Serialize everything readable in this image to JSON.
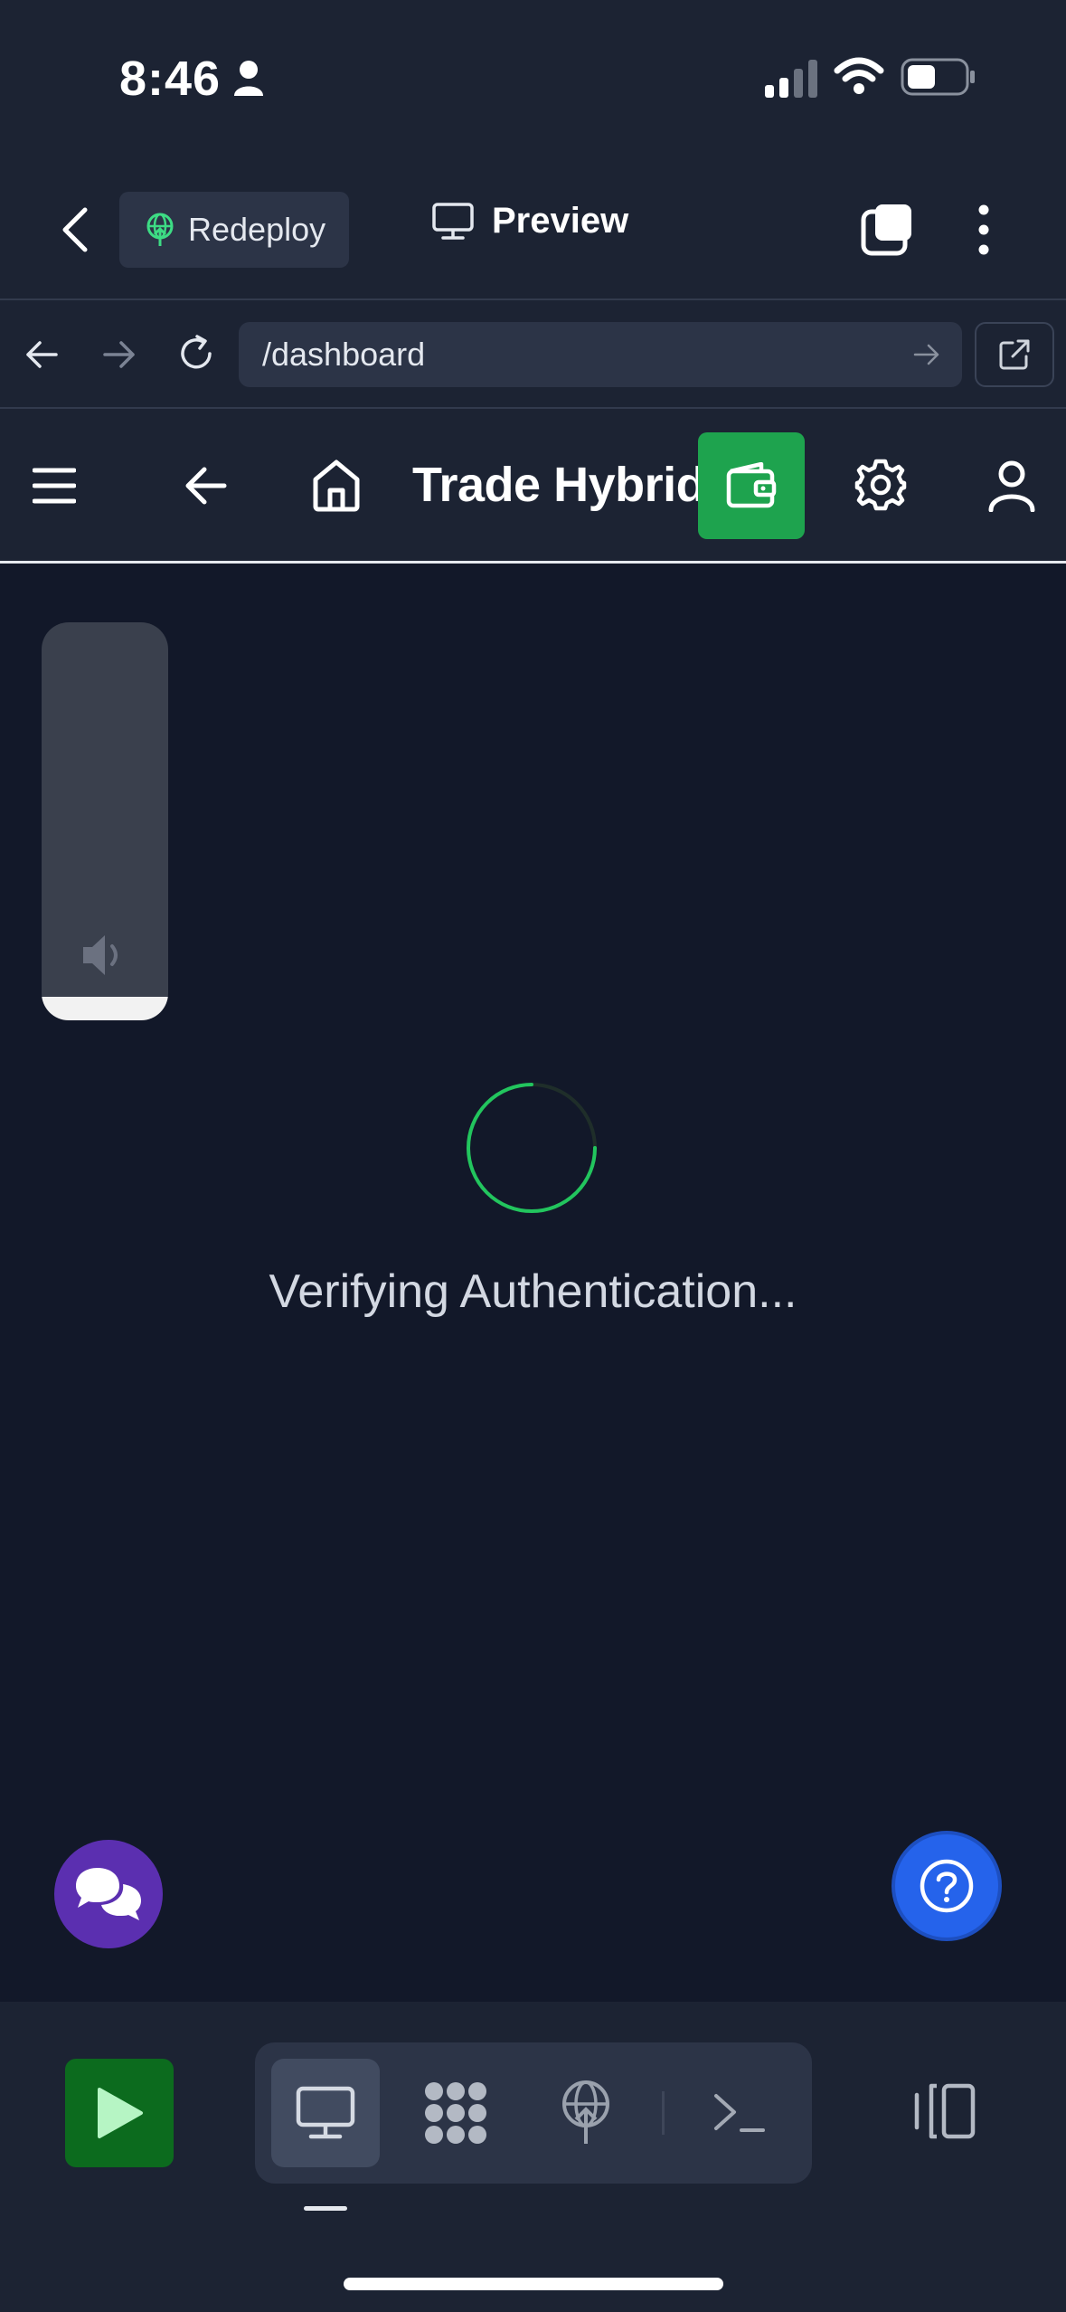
{
  "status_bar": {
    "time": "8:46"
  },
  "top_bar": {
    "redeploy_label": "Redeploy",
    "preview_label": "Preview"
  },
  "url_bar": {
    "path": "/dashboard"
  },
  "app_header": {
    "title": "Trade Hybrid"
  },
  "main": {
    "loading_text": "Verifying Authentication..."
  },
  "colors": {
    "accent_green": "#1ea34e",
    "run_green": "#0c6b1e",
    "chat_purple": "#5b2fb0",
    "help_blue": "#2563eb"
  },
  "icons": {
    "status": [
      "person-icon",
      "cellular-signal-icon",
      "wifi-icon",
      "battery-icon"
    ],
    "top_bar": [
      "back-chevron-icon",
      "deploy-globe-icon",
      "monitor-icon",
      "tabs-icon",
      "more-vertical-icon"
    ],
    "url_bar": [
      "back-arrow-icon",
      "forward-arrow-icon",
      "reload-icon",
      "go-arrow-icon",
      "open-external-icon"
    ],
    "app_header": [
      "menu-icon",
      "back-arrow-icon",
      "home-icon",
      "wallet-icon",
      "settings-gear-icon",
      "user-icon"
    ],
    "bottom_bar": [
      "play-icon",
      "monitor-icon",
      "apps-grid-icon",
      "deploy-globe-icon",
      "terminal-icon",
      "split-view-icon"
    ]
  }
}
